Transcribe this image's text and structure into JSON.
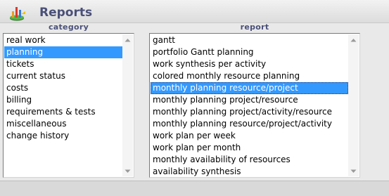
{
  "header": {
    "title": "Reports",
    "icon": "report-chart-icon"
  },
  "category": {
    "label": "category",
    "items": [
      "real work",
      "planning",
      "tickets",
      "current status",
      "costs",
      "billing",
      "requirements & tests",
      "miscellaneous",
      "change history"
    ],
    "selected": "planning"
  },
  "report": {
    "label": "report",
    "items": [
      "gantt",
      "portfolio Gantt planning",
      "work synthesis per activity",
      "colored monthly resource planning",
      "monthly planning resource/project",
      "monthly planning project/resource",
      "monthly planning project/activity/resource",
      "monthly planning resource/project/activity",
      "work plan per week",
      "work plan per month",
      "monthly availability of resources",
      "availability synthesis"
    ],
    "selected": "monthly planning resource/project"
  },
  "colors": {
    "selection": "#3399ff",
    "title": "#4a5078"
  }
}
